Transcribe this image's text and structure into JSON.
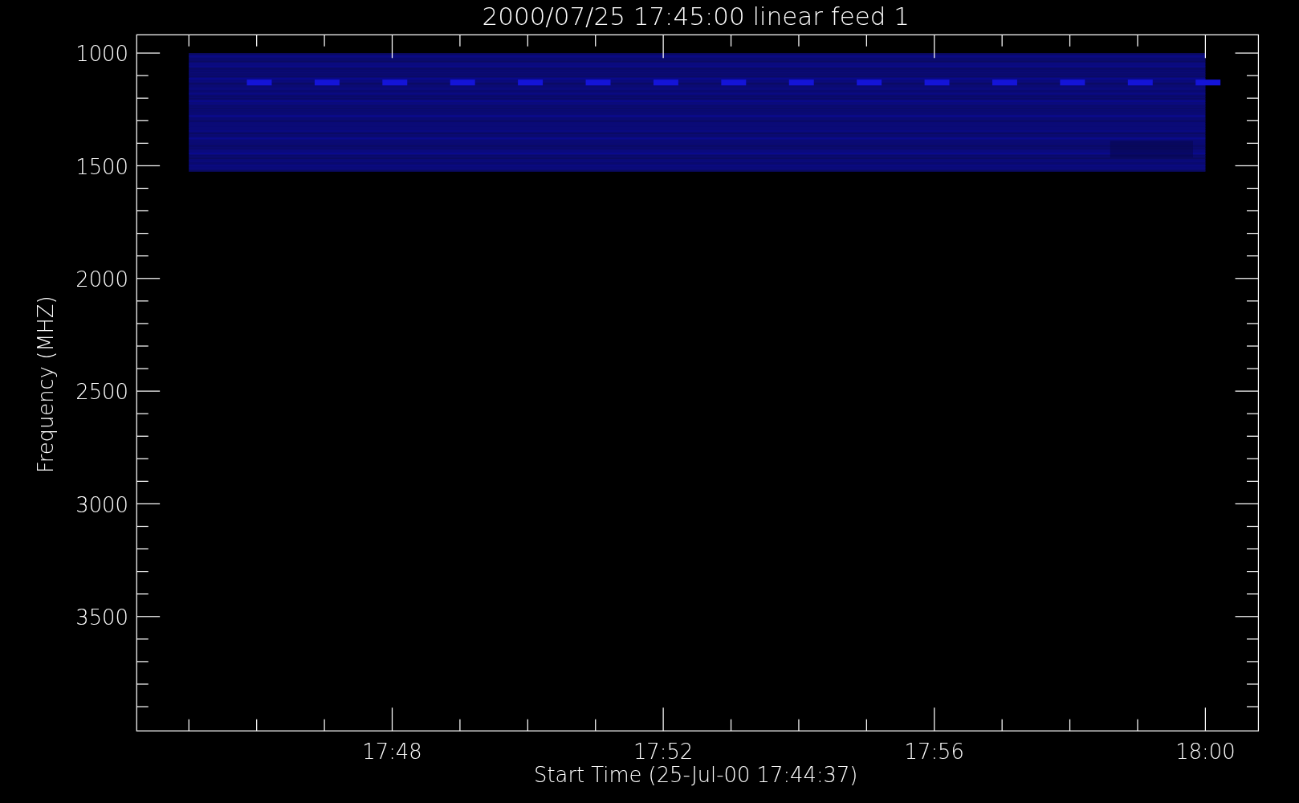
{
  "plot": {
    "title": "2000/07/25 17:45:00 linear feed 1",
    "ylabel": "Frequency (MHZ)",
    "xlabel": "Start Time (25-Jul-00 17:44:37)",
    "yticks": [
      "1000",
      "1500",
      "2000",
      "2500",
      "3000",
      "3500"
    ],
    "xticks": [
      "17:48",
      "17:52",
      "17:56",
      "18:00"
    ]
  }
}
